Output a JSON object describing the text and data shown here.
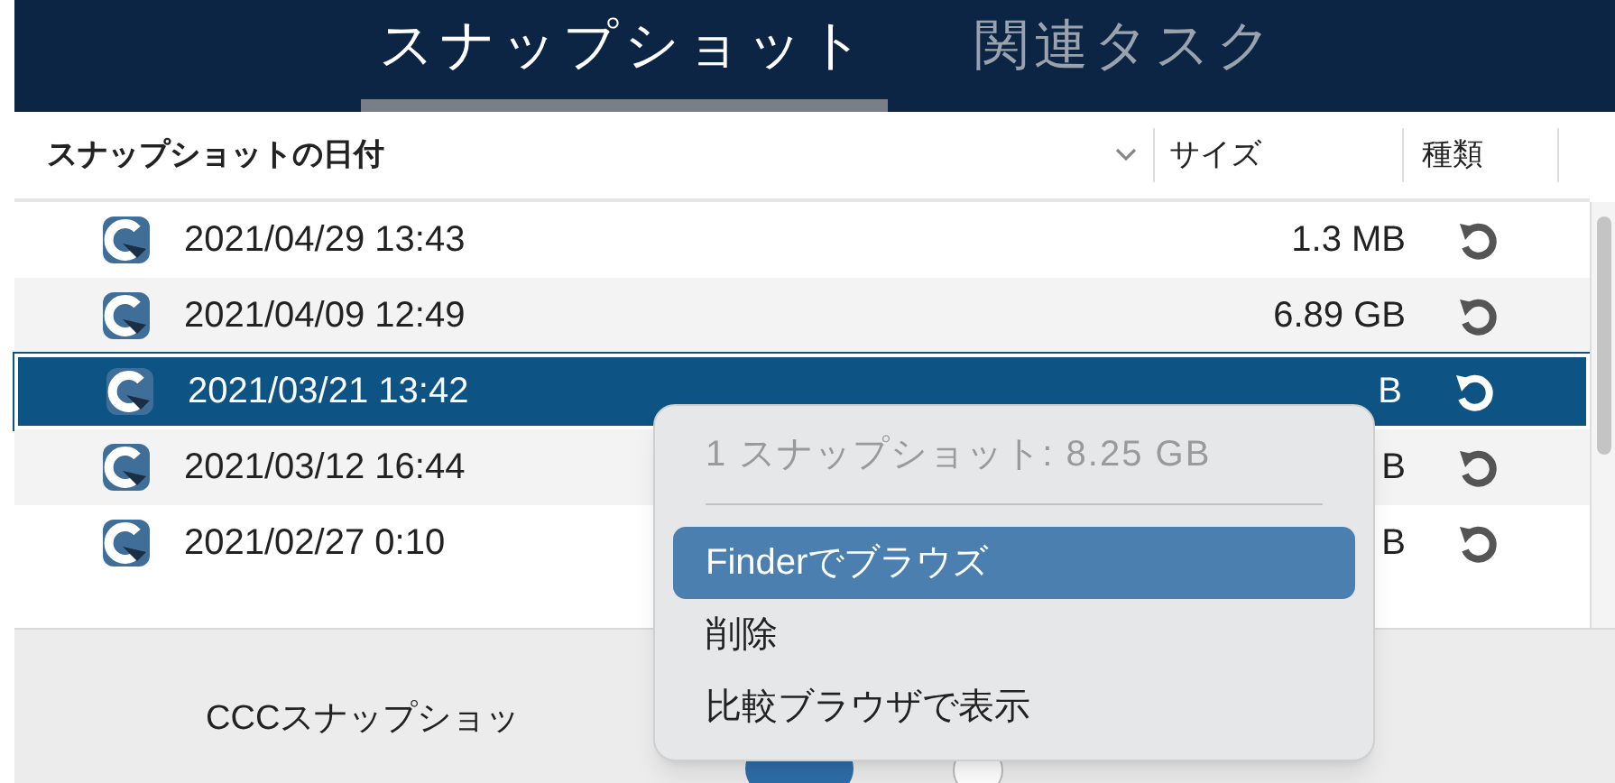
{
  "tabs": [
    {
      "label": "スナップショット",
      "selected": true
    },
    {
      "label": "関連タスク",
      "selected": false
    }
  ],
  "table": {
    "columns": [
      "スナップショットの日付",
      "サイズ",
      "種類"
    ],
    "rows": [
      {
        "date": "2021/04/29 13:43",
        "size": "1.3 MB",
        "selected": false
      },
      {
        "date": "2021/04/09 12:49",
        "size": "6.89 GB",
        "selected": false
      },
      {
        "date": "2021/03/21 13:42",
        "size": "B",
        "selected": true
      },
      {
        "date": "2021/03/12 16:44",
        "size": "B",
        "selected": false
      },
      {
        "date": "2021/02/27 0:10",
        "size": "B",
        "selected": false
      }
    ]
  },
  "footer": {
    "label": "CCCスナップショッ",
    "toggle_on": true,
    "radio_checked": false
  },
  "context_menu": {
    "header": "1 スナップショット: 8.25 GB",
    "items": [
      {
        "label": "Finderでブラウズ",
        "selected": true
      },
      {
        "label": "削除",
        "selected": false
      },
      {
        "label": "比較ブラウザで表示",
        "selected": false
      }
    ]
  }
}
